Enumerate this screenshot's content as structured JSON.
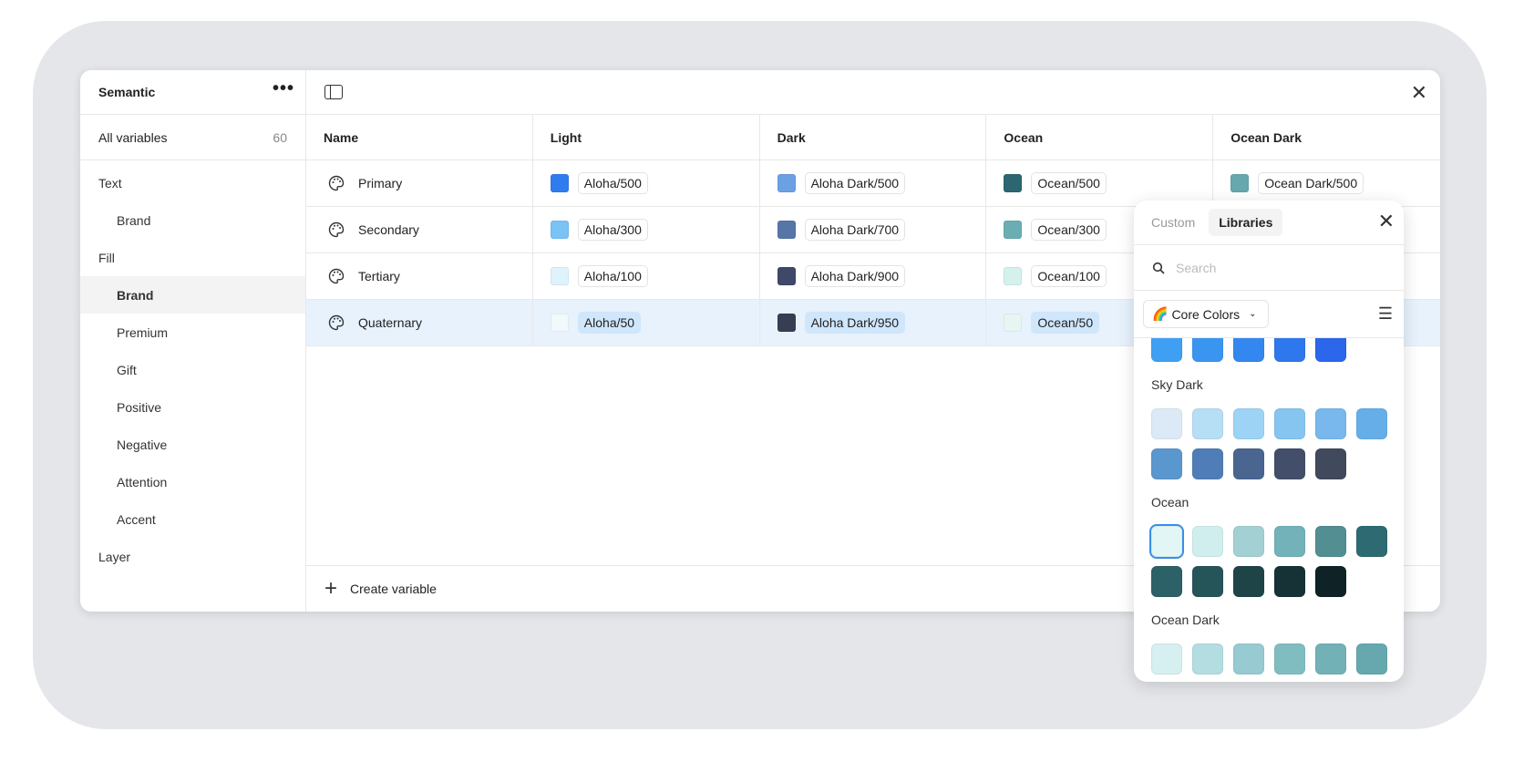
{
  "sidebar": {
    "title": "Semantic",
    "more_icon": "ellipsis-icon",
    "all_label": "All variables",
    "all_count": "60",
    "items": [
      {
        "label": "Text",
        "sub": false
      },
      {
        "label": "Brand",
        "sub": true
      },
      {
        "label": "Fill",
        "sub": false
      },
      {
        "label": "Brand",
        "sub": true,
        "active": true
      },
      {
        "label": "Premium",
        "sub": true
      },
      {
        "label": "Gift",
        "sub": true
      },
      {
        "label": "Positive",
        "sub": true
      },
      {
        "label": "Negative",
        "sub": true
      },
      {
        "label": "Attention",
        "sub": true
      },
      {
        "label": "Accent",
        "sub": true
      },
      {
        "label": "Layer",
        "sub": false
      }
    ]
  },
  "table": {
    "headers": [
      "Name",
      "Light",
      "Dark",
      "Ocean",
      "Ocean Dark"
    ],
    "rows": [
      {
        "name": "Primary",
        "cells": [
          {
            "color": "#2f7cf0",
            "value": "Aloha/500"
          },
          {
            "color": "#6ba1e3",
            "value": "Aloha Dark/500"
          },
          {
            "color": "#2c6670",
            "value": "Ocean/500"
          },
          {
            "color": "#66a8ae",
            "value": "Ocean Dark/500"
          }
        ]
      },
      {
        "name": "Secondary",
        "cells": [
          {
            "color": "#79c3f5",
            "value": "Aloha/300"
          },
          {
            "color": "#5676a8",
            "value": "Aloha Dark/700"
          },
          {
            "color": "#6aaeb3",
            "value": "Ocean/300"
          }
        ]
      },
      {
        "name": "Tertiary",
        "cells": [
          {
            "color": "#dff3fc",
            "value": "Aloha/100"
          },
          {
            "color": "#3f4868",
            "value": "Aloha Dark/900"
          },
          {
            "color": "#d5f1ee",
            "value": "Ocean/100"
          }
        ]
      },
      {
        "name": "Quaternary",
        "selected": true,
        "cells": [
          {
            "color": "#f1f9fd",
            "value": "Aloha/50"
          },
          {
            "color": "#373d52",
            "value": "Aloha Dark/950"
          },
          {
            "color": "#e8f6f3",
            "value": "Ocean/50"
          }
        ]
      }
    ]
  },
  "footer": {
    "create_label": "Create variable"
  },
  "picker": {
    "tabs": [
      "Custom",
      "Libraries"
    ],
    "active_tab": "Libraries",
    "search_placeholder": "Search",
    "library": "Core Colors",
    "library_icon": "rainbow-icon",
    "groups": [
      {
        "label": "",
        "colors": [
          "#3fa0f3",
          "#3a95f0",
          "#3487ee",
          "#2f77ec",
          "#2b66eb"
        ]
      },
      {
        "label": "Sky Dark",
        "colors": [
          "#dceaf7",
          "#b6def5",
          "#9dd3f4",
          "#86c5ef",
          "#78b8ec",
          "#66aee8",
          "#5b97cf",
          "#4f7db8",
          "#4a6590",
          "#434e6b",
          "#41495c"
        ]
      },
      {
        "label": "Ocean",
        "colors": [
          "#e3f6f6",
          "#d0eeee",
          "#a3d0d2",
          "#72b2b8",
          "#528e92",
          "#2e6a72",
          "#2b6167",
          "#265559",
          "#1f4448",
          "#163237",
          "#0f2226"
        ],
        "selected_index": 0
      },
      {
        "label": "Ocean Dark",
        "colors": [
          "#d6eff0",
          "#b3dde0",
          "#97cad1",
          "#80bdc1",
          "#72b1b6",
          "#66a8ae"
        ]
      }
    ],
    "selection_color": "#3a8ee8"
  }
}
